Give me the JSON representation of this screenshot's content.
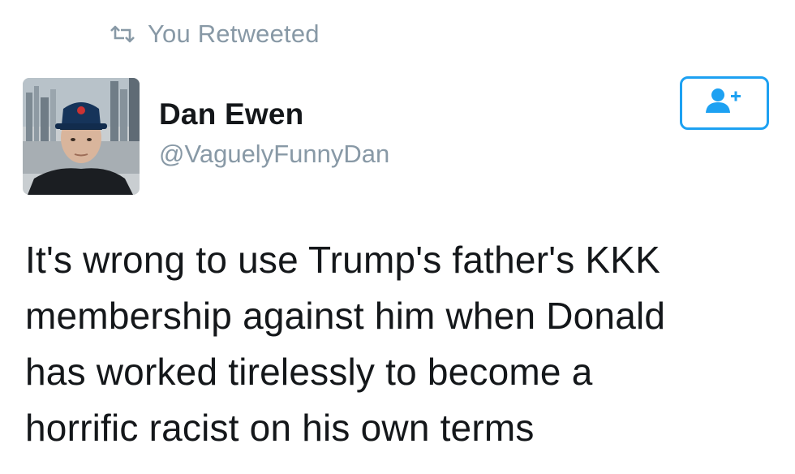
{
  "retweet_header": {
    "icon": "retweet-icon",
    "label": "You Retweeted"
  },
  "author": {
    "name": "Dan Ewen",
    "handle": "@VaguelyFunnyDan",
    "avatar": "avatar-photo"
  },
  "follow_button": {
    "icon": "follow-user-plus-icon"
  },
  "tweet": {
    "lines": [
      "It's wrong to use Trump's father's KKK",
      "membership against him when Donald",
      "has worked tirelessly to become a",
      "horrific racist on his own terms"
    ]
  },
  "colors": {
    "accent": "#1da1f2",
    "muted": "#8899a6",
    "text": "#14171a"
  }
}
